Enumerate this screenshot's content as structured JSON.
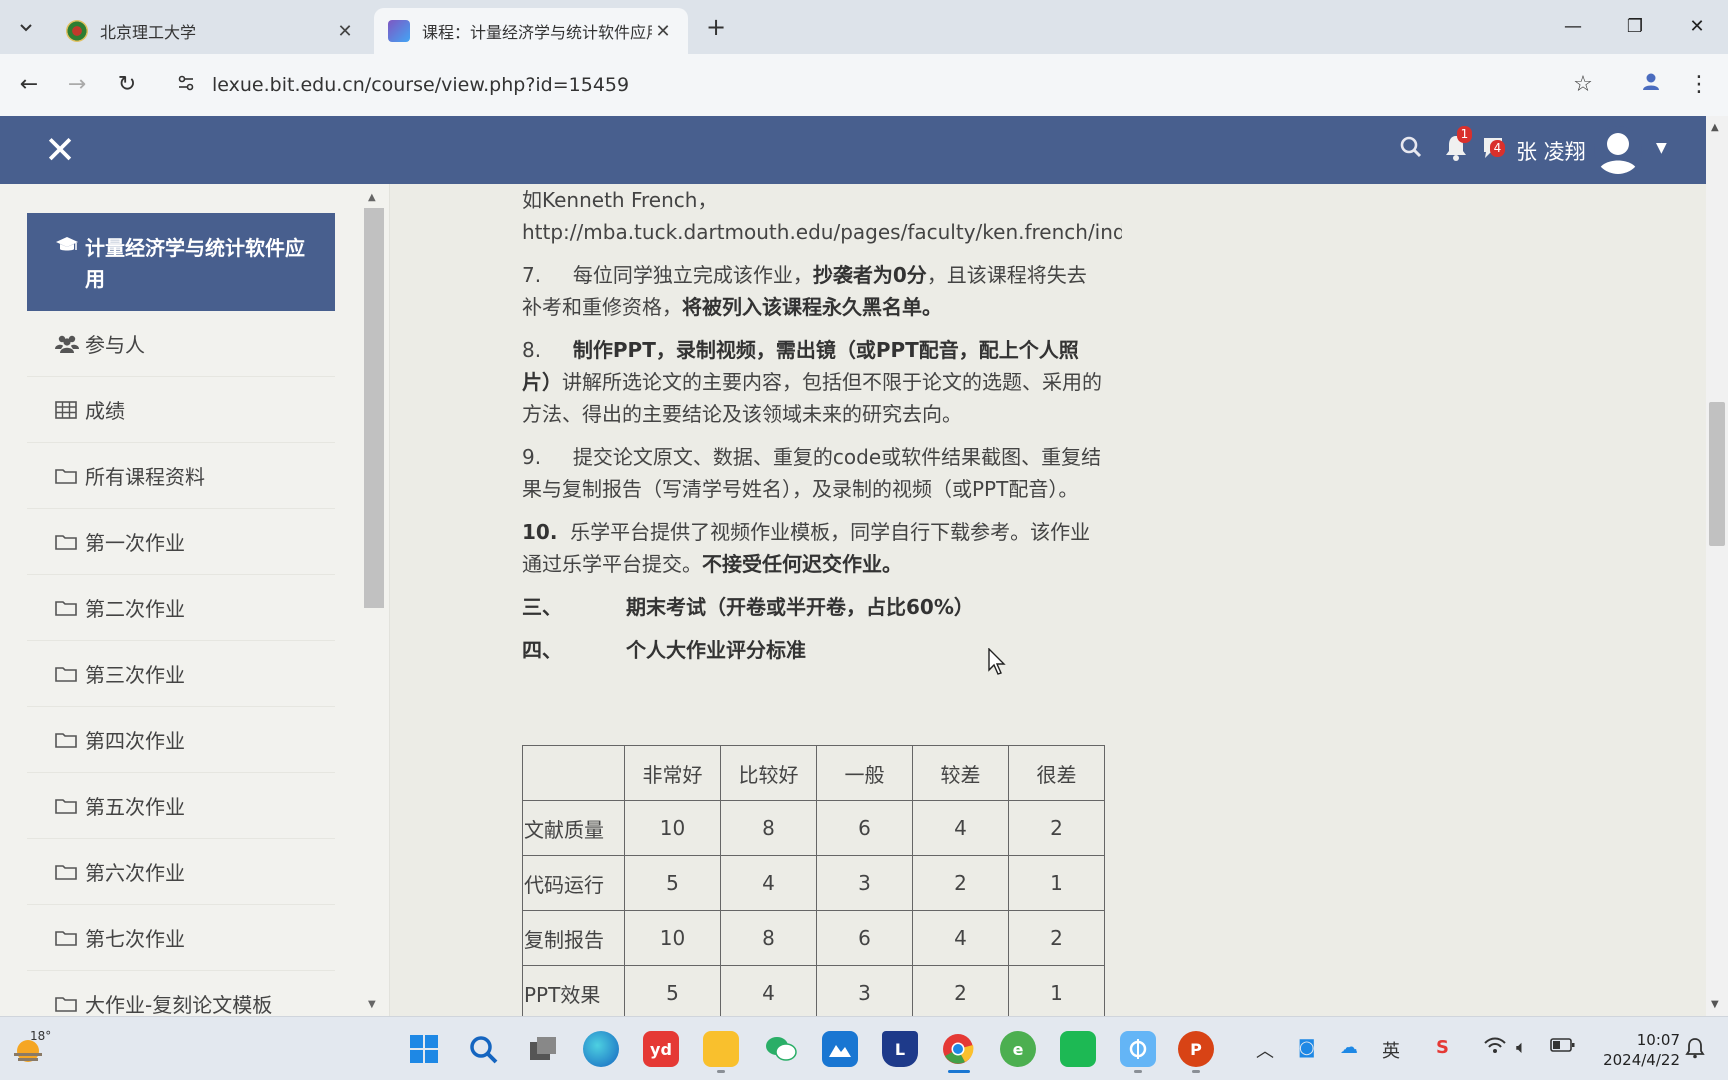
{
  "browser": {
    "tabs": [
      {
        "title": "北京理工大学",
        "active": false
      },
      {
        "title": "课程：计量经济学与统计软件应用",
        "active": true
      }
    ],
    "url": "lexue.bit.edu.cn/course/view.php?id=15459"
  },
  "navbar": {
    "notification_count": "1",
    "message_count": "4",
    "user_name": "张 凌翔"
  },
  "drawer": {
    "course_title": "计量经济学与统计软件应用",
    "items": [
      {
        "label": "参与人",
        "icon": "users-icon"
      },
      {
        "label": "成绩",
        "icon": "table-icon"
      },
      {
        "label": "所有课程资料",
        "icon": "folder-icon"
      },
      {
        "label": "第一次作业",
        "icon": "folder-icon"
      },
      {
        "label": "第二次作业",
        "icon": "folder-icon"
      },
      {
        "label": "第三次作业",
        "icon": "folder-icon"
      },
      {
        "label": "第四次作业",
        "icon": "folder-icon"
      },
      {
        "label": "第五次作业",
        "icon": "folder-icon"
      },
      {
        "label": "第六次作业",
        "icon": "folder-icon"
      },
      {
        "label": "第七次作业",
        "icon": "folder-icon"
      },
      {
        "label": "大作业-复刻论文模板",
        "icon": "folder-icon"
      }
    ]
  },
  "content": {
    "intro_line1": "如Kenneth French，",
    "intro_line2": "http://mba.tuck.dartmouth.edu/pages/faculty/ken.french/index",
    "item7": {
      "num": "7.",
      "a": "每位同学独立完成该作业，",
      "b": "抄袭者为0分",
      "c": "，且该课程将失去补考和重修资格，",
      "d": "将被列入该课程永久黑名单。"
    },
    "item8": {
      "num": "8.",
      "a": "制作PPT，录制视频，需出镜（或PPT配音，配上个人照片）",
      "b": "讲解所选论文的主要内容，包括但不限于论文的选题、采用的方法、得出的主要结论及该领域未来的研究去向。"
    },
    "item9": {
      "num": "9.",
      "a": "提交论文原文、数据、重复的code或软件结果截图、重复结果与复制报告（写清学号姓名），及录制的视频（或PPT配音）。"
    },
    "item10": {
      "num": "10.",
      "a": "乐学平台提供了视频作业模板，同学自行下载参考。该作业通过乐学平台提交。",
      "b": "不接受任何迟交作业。"
    },
    "section3": {
      "num": "三、",
      "title": "期末考试（开卷或半开卷，占比60%）"
    },
    "section4": {
      "num": "四、",
      "title": "个人大作业评分标准"
    }
  },
  "grading_table": {
    "columns": [
      "",
      "非常好",
      "比较好",
      "一般",
      "较差",
      "很差"
    ],
    "rows": [
      {
        "label": "文献质量",
        "values": [
          "10",
          "8",
          "6",
          "4",
          "2"
        ]
      },
      {
        "label": "代码运行",
        "values": [
          "5",
          "4",
          "3",
          "2",
          "1"
        ]
      },
      {
        "label": "复制报告",
        "values": [
          "10",
          "8",
          "6",
          "4",
          "2"
        ]
      },
      {
        "label": "PPT效果",
        "values": [
          "5",
          "4",
          "3",
          "2",
          "1"
        ]
      }
    ]
  },
  "taskbar": {
    "weather_temp": "18°",
    "ime_label": "英",
    "time": "10:07",
    "date": "2024/4/22"
  },
  "colors": {
    "navbar": "#485f8e",
    "page_background": "#ecece6",
    "badge": "#d9302c"
  }
}
